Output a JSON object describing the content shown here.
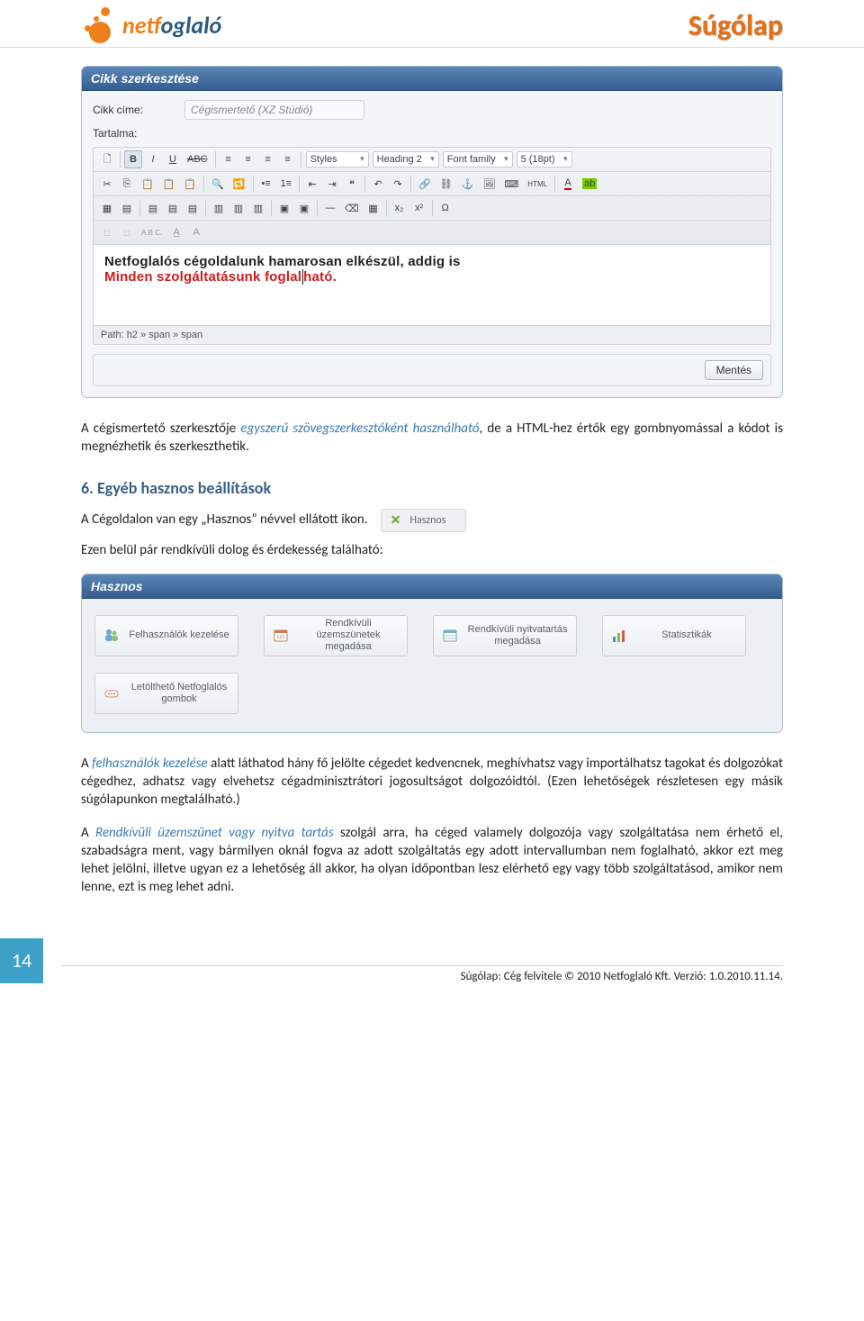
{
  "header": {
    "logo_text_1": "net",
    "logo_text_2": "foglaló",
    "page_title": "Súgólap"
  },
  "editor": {
    "panel_title": "Cikk szerkesztése",
    "title_label": "Cikk címe:",
    "title_value": "Cégismertető (XZ Stúdió)",
    "content_label": "Tartalma:",
    "styles_dd": "Styles",
    "format_dd": "Heading 2",
    "fontfam_dd": "Font family",
    "fontsize_dd": "5 (18pt)",
    "canvas_line1": "Netfoglalós cégoldalunk hamarosan elkészül, addig is",
    "canvas_line2a": "Minden szolgáltatásunk foglal",
    "canvas_line2b": "ható.",
    "path": "Path: h2 » span » span",
    "save_btn": "Mentés"
  },
  "body": {
    "p1_a": "A cégismertető szerkesztője ",
    "p1_hl": "egyszerű szövegszerkesztőként használható",
    "p1_b": ", de a HTML-hez értők egy gombnyomással a kódot is megnézhetik és szerkeszthetik.",
    "h6_num": "6.",
    "h6_txt": "Egyéb hasznos beállítások",
    "p2": "A Cégoldalon van egy „Hasznos” névvel ellátott ikon.",
    "hasznos_tab": "Hasznos",
    "p3": "Ezen belül pár rendkívüli dolog és érdekesség található:"
  },
  "hasznos_panel": {
    "title": "Hasznos",
    "items": [
      "Felhasználók kezelése",
      "Rendkívüli üzemszünetek megadása",
      "Rendkívüli nyitvatartás megadása",
      "Statisztikák",
      "Letölthető Netfoglalós gombok"
    ]
  },
  "body2": {
    "p4_a": "A ",
    "p4_hl1": "felhasználók kezelése",
    "p4_b": " alatt láthatod hány fő jelölte cégedet kedvencnek, meghívhatsz vagy importálhatsz tagokat és dolgozókat cégedhez, adhatsz vagy elvehetsz cégadminisztrátori jogosultságot dolgozóidtól. (Ezen lehetőségek részletesen egy másik súgólapunkon megtalálható.)",
    "p5_a": "A ",
    "p5_hl": "Rendkívüli üzemszünet vagy nyitva tartás",
    "p5_b": " szolgál arra, ha céged valamely dolgozója vagy szolgáltatása nem érhető el, szabadságra ment, vagy bármilyen oknál fogva az adott szolgáltatás egy adott intervallumban nem foglalható, akkor ezt meg lehet jelölni, illetve ugyan ez a lehetőség áll akkor, ha olyan időpontban lesz elérhető egy vagy több szolgáltatásod, amikor nem lenne, ezt is meg lehet adni."
  },
  "footer": {
    "page": "14",
    "text": "Súgólap: Cég felvitele   © 2010 Netfoglaló Kft. Verzió: 1.0.2010.11.14."
  }
}
